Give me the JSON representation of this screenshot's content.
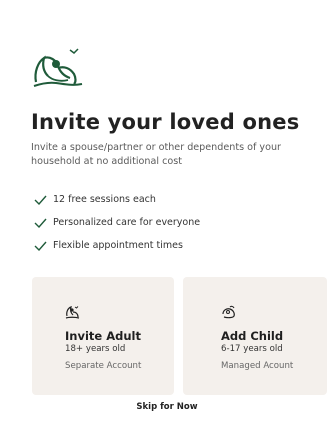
{
  "header": {
    "logo_icon": "bird-and-woman-logo-icon",
    "title": "Invite your loved ones",
    "subtitle": "Invite a spouse/partner or other dependents of your household at no additional cost"
  },
  "features": [
    {
      "icon": "check-icon",
      "label": "12 free sessions each"
    },
    {
      "icon": "check-icon",
      "label": "Personalized care for everyone"
    },
    {
      "icon": "check-icon",
      "label": "Flexible appointment times"
    }
  ],
  "options": {
    "adult": {
      "icon": "adult-icon",
      "title": "Invite Adult",
      "age": "18+ years old",
      "account": "Separate Account"
    },
    "child": {
      "icon": "child-icon",
      "title": "Add Child",
      "age": "6-17 years old",
      "account": "Managed Acount"
    }
  },
  "footer": {
    "skip_label": "Skip for Now"
  },
  "colors": {
    "brand_green": "#1f5b3a",
    "card_bg": "#f4f0ec",
    "text": "#1f1f1f"
  }
}
